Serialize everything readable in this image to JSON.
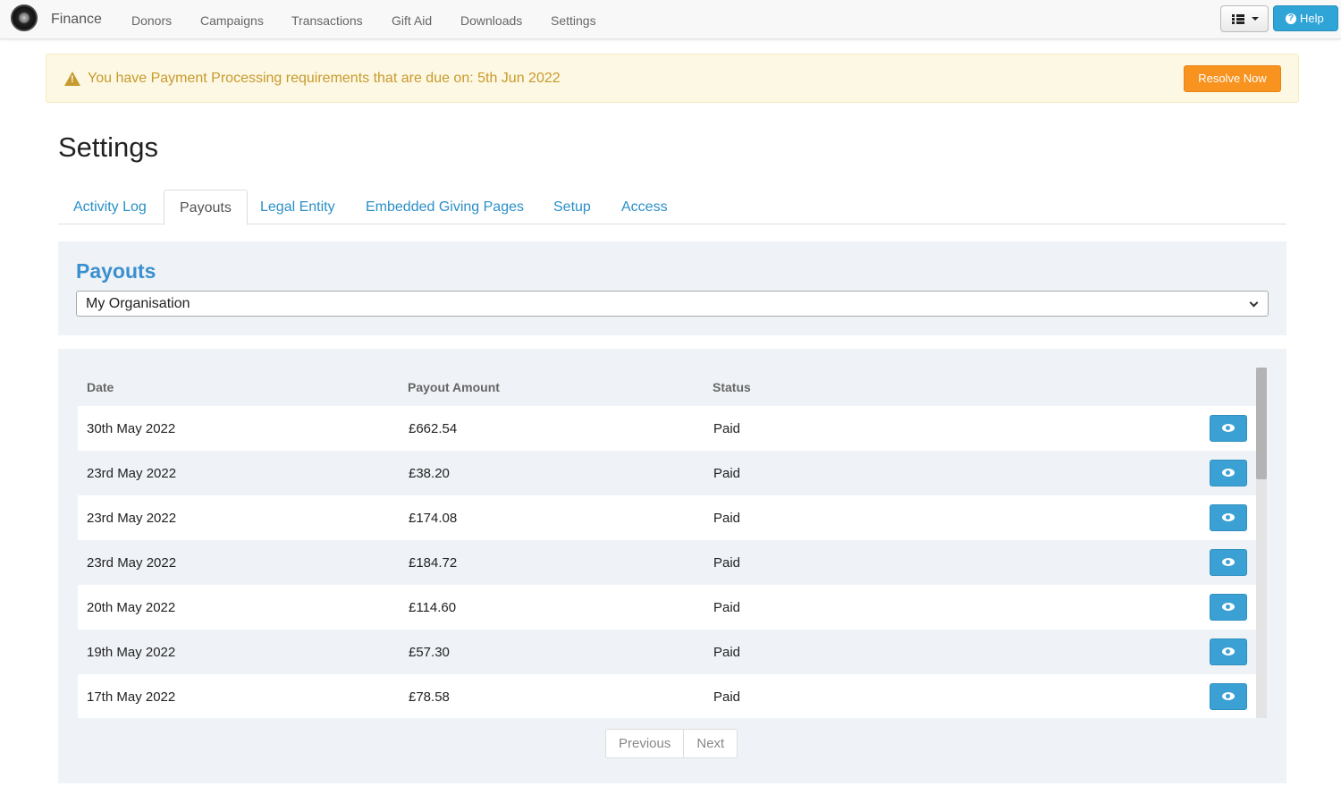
{
  "nav": {
    "brand": "Finance",
    "items": [
      "Donors",
      "Campaigns",
      "Transactions",
      "Gift Aid",
      "Downloads",
      "Settings"
    ],
    "help_label": "Help"
  },
  "alert": {
    "message": "You have Payment Processing requirements that are due on: 5th Jun 2022",
    "action_label": "Resolve Now"
  },
  "page_title": "Settings",
  "tabs": [
    "Activity Log",
    "Payouts",
    "Legal Entity",
    "Embedded Giving Pages",
    "Setup",
    "Access"
  ],
  "active_tab": "Payouts",
  "payouts": {
    "title": "Payouts",
    "organisation_select": "My Organisation"
  },
  "table": {
    "headers": [
      "Date",
      "Payout Amount",
      "Status"
    ],
    "rows": [
      {
        "date": "30th May 2022",
        "amount": "£662.54",
        "status": "Paid"
      },
      {
        "date": "23rd May 2022",
        "amount": "£38.20",
        "status": "Paid"
      },
      {
        "date": "23rd May 2022",
        "amount": "£174.08",
        "status": "Paid"
      },
      {
        "date": "23rd May 2022",
        "amount": "£184.72",
        "status": "Paid"
      },
      {
        "date": "20th May 2022",
        "amount": "£114.60",
        "status": "Paid"
      },
      {
        "date": "19th May 2022",
        "amount": "£57.30",
        "status": "Paid"
      },
      {
        "date": "17th May 2022",
        "amount": "£78.58",
        "status": "Paid"
      }
    ]
  },
  "pagination": {
    "previous_label": "Previous",
    "next_label": "Next"
  }
}
